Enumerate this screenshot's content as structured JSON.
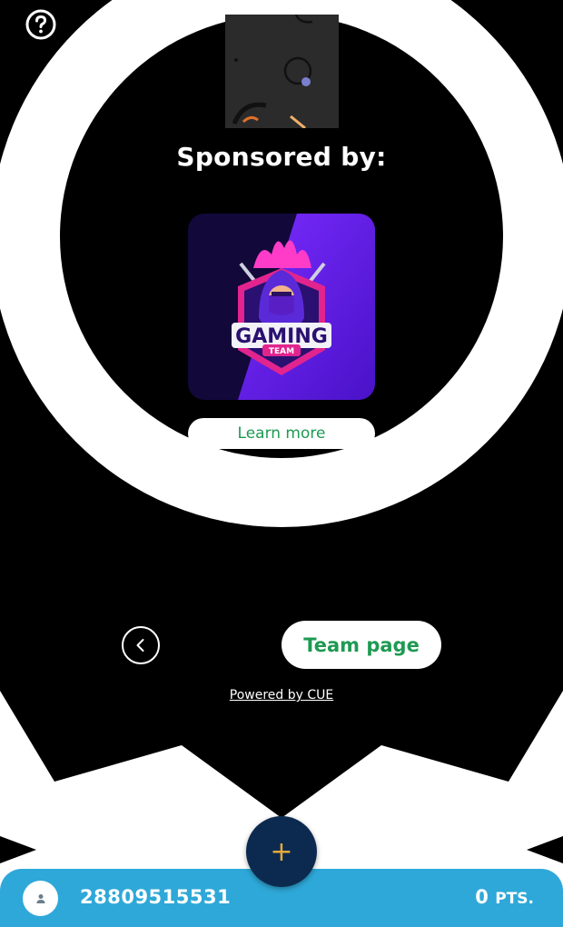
{
  "colors": {
    "accent_green": "#1e9a53",
    "bottom_bar": "#2ea8d8",
    "fab_background": "#0c2a4f",
    "fab_plus": "#e6a93a"
  },
  "header": {
    "help_icon": "question-circle-icon"
  },
  "sponsor": {
    "heading": "Sponsored by:",
    "logo_text_main": "GAMING",
    "logo_text_badge": "TEAM",
    "learn_more_label": "Learn more"
  },
  "navigation": {
    "back_icon": "chevron-left-icon",
    "team_page_label": "Team page"
  },
  "footer": {
    "powered_by": "Powered by CUE"
  },
  "bottom_bar": {
    "user_id": "28809515531",
    "points_value": "0",
    "points_unit": "PTS.",
    "avatar_icon": "user-icon"
  },
  "fab": {
    "label": "+"
  }
}
